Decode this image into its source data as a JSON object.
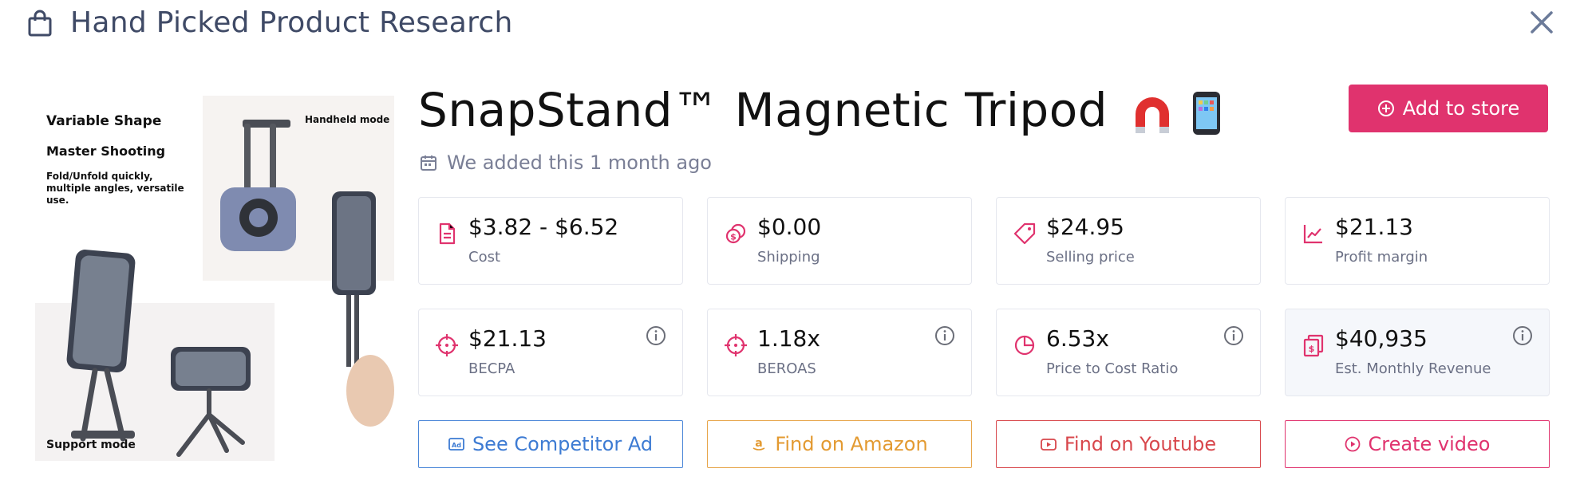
{
  "header": {
    "title": "Hand Picked Product Research"
  },
  "image": {
    "text_1": "Variable Shape",
    "text_2": "Master Shooting",
    "text_3": "Fold/Unfold quickly, multiple angles, versatile use.",
    "text_4": "Handheld mode",
    "text_5": "Support mode"
  },
  "product": {
    "title": "SnapStand™ Magnetic Tripod",
    "added": "We added this 1 month ago"
  },
  "add_button": {
    "label": "Add to store"
  },
  "metrics": [
    {
      "value": "$3.82 - $6.52",
      "label": "Cost"
    },
    {
      "value": "$0.00",
      "label": "Shipping"
    },
    {
      "value": "$24.95",
      "label": "Selling price"
    },
    {
      "value": "$21.13",
      "label": "Profit margin"
    },
    {
      "value": "$21.13",
      "label": "BECPA"
    },
    {
      "value": "1.18x",
      "label": "BEROAS"
    },
    {
      "value": "6.53x",
      "label": "Price to Cost Ratio"
    },
    {
      "value": "$40,935",
      "label": "Est. Monthly Revenue"
    }
  ],
  "actions": [
    {
      "label": "See Competitor Ad"
    },
    {
      "label": "Find on Amazon"
    },
    {
      "label": "Find on Youtube"
    },
    {
      "label": "Create video"
    }
  ],
  "colors": {
    "accent": "#e0336e",
    "blue": "#3d7bd3",
    "orange": "#e39a31",
    "red": "#d8474c",
    "title": "#3f4a66"
  }
}
